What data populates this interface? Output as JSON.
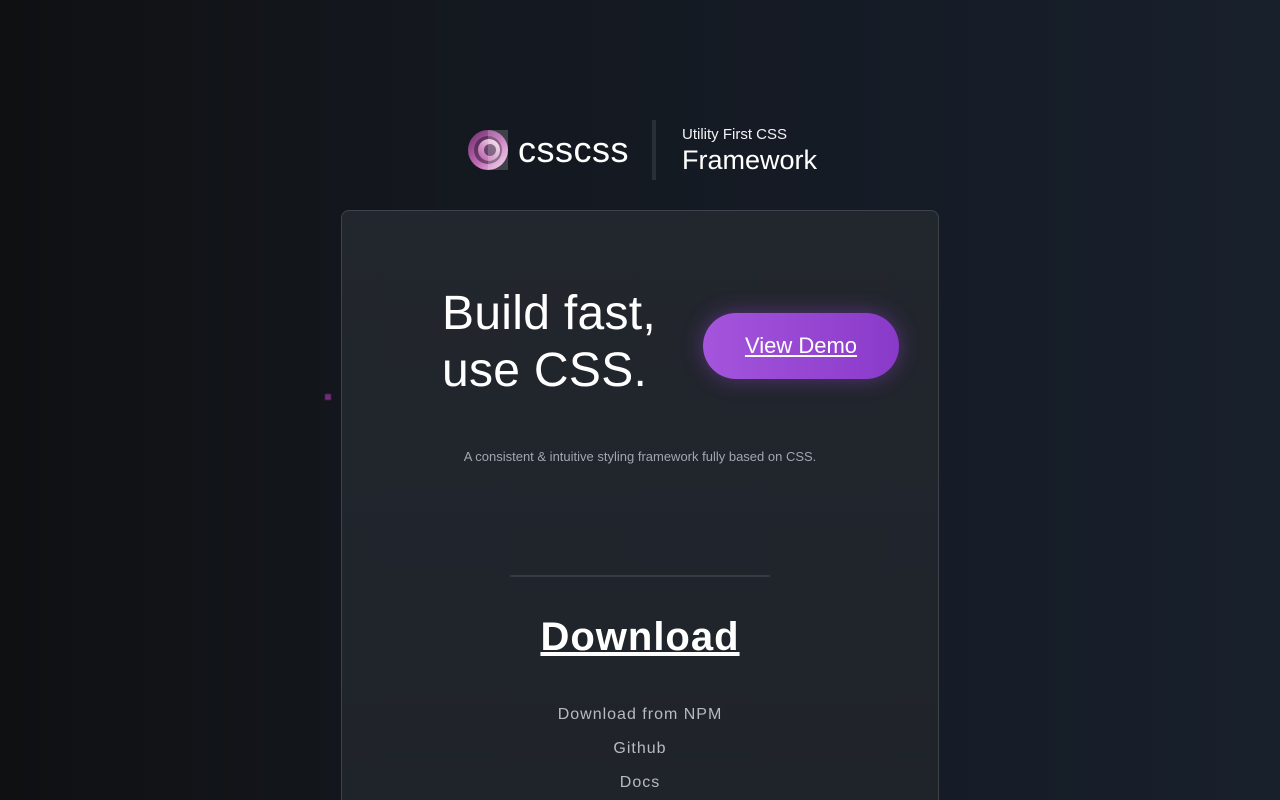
{
  "header": {
    "brand_name": "csscss",
    "tagline_small": "Utility First CSS",
    "tagline_large": "Framework",
    "logo_icon": "layered-circle-logo"
  },
  "hero": {
    "headline_line1": "Build fast,",
    "headline_line2": "use CSS.",
    "demo_button_label": "View Demo",
    "description": "A consistent & intuitive styling framework fully based on CSS."
  },
  "download": {
    "heading": "Download",
    "links": [
      {
        "label": "Download from NPM"
      },
      {
        "label": "Github"
      },
      {
        "label": "Docs"
      }
    ]
  },
  "colors": {
    "accent_start": "#a455dc",
    "accent_end": "#8a3ac9",
    "card_bg": "#22262d",
    "page_bg_dark": "#0f1012",
    "page_bg_light": "#18202c",
    "muted_text": "#a2a6ae"
  }
}
